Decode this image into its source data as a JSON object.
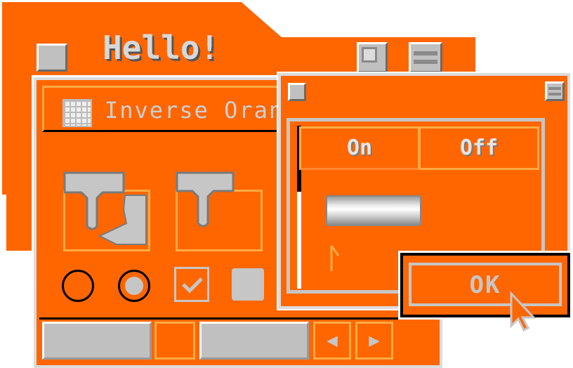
{
  "colors": {
    "accent": "#ff6600",
    "face": "#c0c0c0",
    "shadow": "#6a6a6a",
    "light": "#ffffff"
  },
  "back_window": {
    "title": "Hello!"
  },
  "theme_window": {
    "title": "Inverse Oran",
    "icon": "grid-icon"
  },
  "dialog": {
    "tabs": [
      {
        "label": "On"
      },
      {
        "label": "Off"
      }
    ],
    "ok_label": "OK"
  },
  "bottom_toolbar": {
    "left_arrow": "◀",
    "right_arrow": "▶"
  }
}
